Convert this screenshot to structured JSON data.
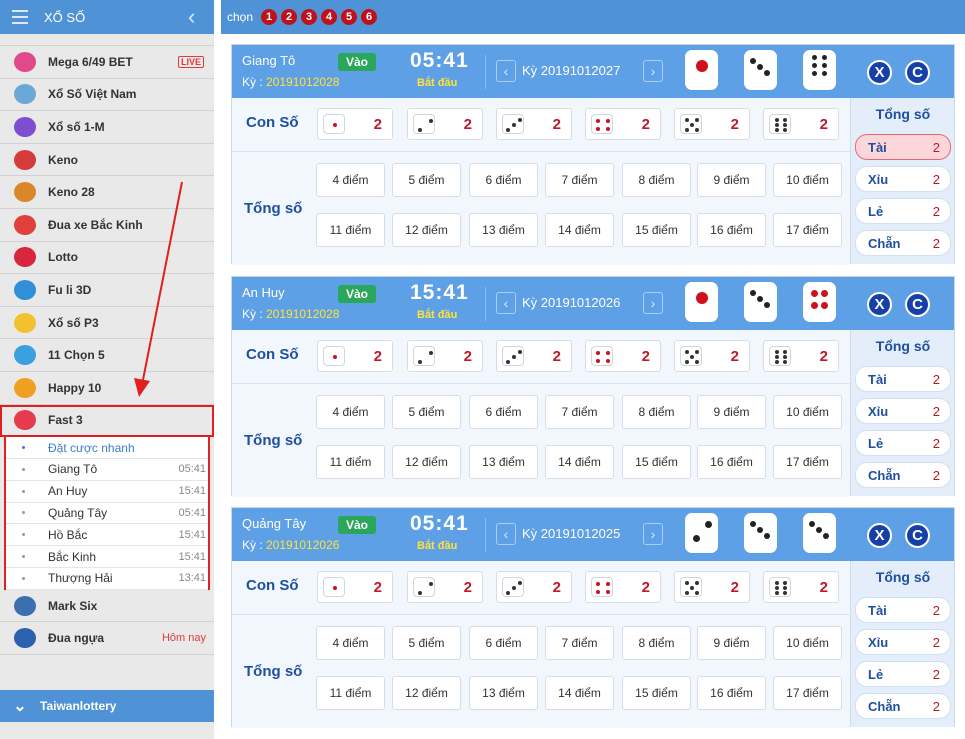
{
  "sidebar": {
    "title": "XỔ SỐ",
    "items": [
      {
        "label": "Mega 6/49 BET",
        "icon": "mega-icon",
        "badge": "LIVE",
        "color": "#e04a8a"
      },
      {
        "label": "Xổ Số Việt Nam",
        "icon": "xoso-vn-icon",
        "color": "#6aa8d8"
      },
      {
        "label": "Xổ số 1-M",
        "icon": "xoso-1m-icon",
        "color": "#7d4fd0"
      },
      {
        "label": "Keno",
        "icon": "keno-icon",
        "color": "#d63b3b"
      },
      {
        "label": "Keno 28",
        "icon": "keno28-icon",
        "color": "#d8872b"
      },
      {
        "label": "Đua xe Bắc Kinh",
        "icon": "pk10-icon",
        "color": "#e0403b"
      },
      {
        "label": "Lotto",
        "icon": "lotto-icon",
        "color": "#d7263d"
      },
      {
        "label": "Fu li 3D",
        "icon": "fuli3d-icon",
        "color": "#2f8fd8"
      },
      {
        "label": "Xổ số P3",
        "icon": "p3-icon",
        "color": "#f2c12e"
      },
      {
        "label": "11 Chọn 5",
        "icon": "11chon5-icon",
        "color": "#3aa0e0"
      },
      {
        "label": "Happy 10",
        "icon": "happy10-icon",
        "color": "#f0a020"
      },
      {
        "label": "Fast 3",
        "icon": "fast3-icon",
        "color": "#e63b4a"
      }
    ],
    "submenu": [
      {
        "label": "Đặt cược nhanh",
        "time": ""
      },
      {
        "label": "Giang Tô",
        "time": "05:41"
      },
      {
        "label": "An Huy",
        "time": "15:41"
      },
      {
        "label": "Quảng Tây",
        "time": "05:41"
      },
      {
        "label": "Hồ Bắc",
        "time": "15:41"
      },
      {
        "label": "Bắc Kinh",
        "time": "15:41"
      },
      {
        "label": "Thượng Hải",
        "time": "13:41"
      }
    ],
    "after_items": [
      {
        "label": "Mark Six",
        "icon": "marksix-icon",
        "color": "#3a6fb0"
      },
      {
        "label": "Đua ngựa",
        "icon": "horse-icon",
        "badge": "Hôm nay",
        "color": "#2a62b0"
      }
    ],
    "footer": "Taiwanlottery"
  },
  "topbar": {
    "label": "chọn",
    "chips": [
      "1",
      "2",
      "3",
      "4",
      "5",
      "6"
    ]
  },
  "common": {
    "vao": "Vào",
    "ky_prefix": "Kỳ :",
    "bat_dau": "Bắt đầu",
    "con_so": "Con Số",
    "tong_so": "Tổng số",
    "x": "X",
    "c": "C",
    "digit_odds": [
      "2",
      "2",
      "2",
      "2",
      "2",
      "2"
    ],
    "points": [
      "4 điểm",
      "5 điểm",
      "6 điểm",
      "7 điểm",
      "8 điểm",
      "9 điểm",
      "10 điểm",
      "11 điểm",
      "12 điểm",
      "13 điểm",
      "14 điểm",
      "15 điểm",
      "16 điểm",
      "17 điểm"
    ],
    "side": [
      {
        "label": "Tài",
        "odds": "2"
      },
      {
        "label": "Xỉu",
        "odds": "2"
      },
      {
        "label": "Lẻ",
        "odds": "2"
      },
      {
        "label": "Chẵn",
        "odds": "2"
      }
    ]
  },
  "blocks": [
    {
      "name": "Giang Tô",
      "ky": "20191012028",
      "time": "05:41",
      "prev_ky": "Kỳ 20191012027",
      "dice": [
        1,
        3,
        6
      ],
      "selected_side": "Tài"
    },
    {
      "name": "An Huy",
      "ky": "20191012028",
      "time": "15:41",
      "prev_ky": "Kỳ 20191012026",
      "dice": [
        1,
        3,
        4
      ],
      "selected_side": ""
    },
    {
      "name": "Quảng Tây",
      "ky": "20191012026",
      "time": "05:41",
      "prev_ky": "Kỳ 20191012025",
      "dice": [
        2,
        3,
        3
      ],
      "selected_side": ""
    }
  ]
}
